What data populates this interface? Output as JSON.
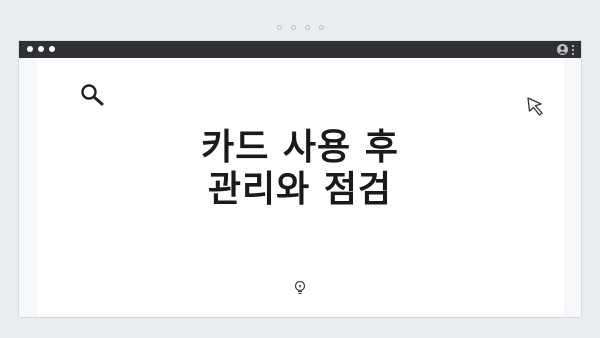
{
  "pager": {
    "count": 4
  },
  "window": {
    "controls": [
      "dot",
      "dot",
      "dot"
    ],
    "icons": {
      "user": "user-icon",
      "menu": "kebab-menu-icon"
    }
  },
  "content": {
    "title_line1": "카드 사용 후",
    "title_line2": "관리와 점검",
    "icons": {
      "search": "search-icon",
      "cursor": "pointer-cursor-icon",
      "bulb": "lightbulb-icon"
    }
  }
}
